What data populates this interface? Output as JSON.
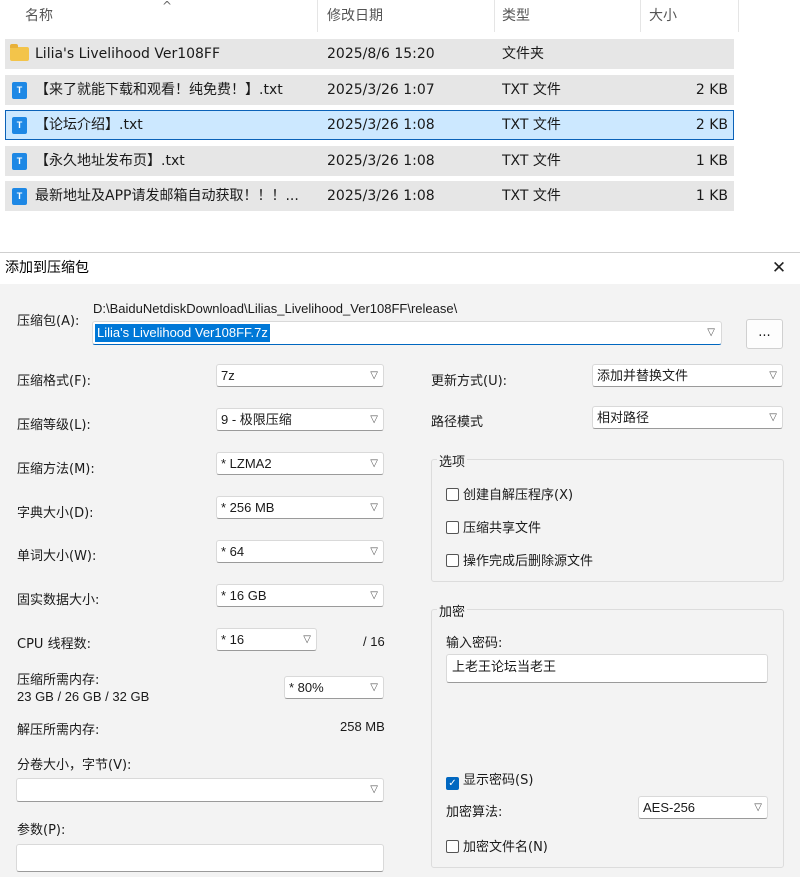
{
  "explorer": {
    "columns": [
      "名称",
      "修改日期",
      "类型",
      "大小"
    ],
    "files": [
      {
        "name": "Lilia's Livelihood Ver108FF",
        "date": "2025/8/6 15:20",
        "type": "文件夹",
        "size": "",
        "icon": "folder-icon"
      },
      {
        "name": "【来了就能下载和观看！纯免费！】.txt",
        "date": "2025/3/26 1:07",
        "type": "TXT 文件",
        "size": "2 KB",
        "icon": "txt-file-icon"
      },
      {
        "name": "【论坛介绍】.txt",
        "date": "2025/3/26 1:08",
        "type": "TXT 文件",
        "size": "2 KB",
        "icon": "txt-file-icon",
        "selected": true
      },
      {
        "name": "【永久地址发布页】.txt",
        "date": "2025/3/26 1:08",
        "type": "TXT 文件",
        "size": "1 KB",
        "icon": "txt-file-icon"
      },
      {
        "name": "最新地址及APP请发邮箱自动获取！！！...",
        "date": "2025/3/26 1:08",
        "type": "TXT 文件",
        "size": "1 KB",
        "icon": "txt-file-icon"
      }
    ]
  },
  "dialog": {
    "title": "添加到压缩包",
    "archive_label": "压缩包(A):",
    "archive_path": "D:\\BaiduNetdiskDownload\\Lilias_Livelihood_Ver108FF\\release\\",
    "archive_name": "Lilia's Livelihood Ver108FF.7z",
    "browse_label": "...",
    "format_label": "压缩格式(F):",
    "format_value": "7z",
    "level_label": "压缩等级(L):",
    "level_value": "9 - 极限压缩",
    "method_label": "压缩方法(M):",
    "method_value": "*  LZMA2",
    "dict_label": "字典大小(D):",
    "dict_value": "*  256 MB",
    "word_label": "单词大小(W):",
    "word_value": "*  64",
    "solid_label": "固实数据大小:",
    "solid_value": "*  16 GB",
    "cpu_label": "CPU 线程数:",
    "cpu_value": "*  16",
    "cpu_total": "/ 16",
    "mem_label": "压缩所需内存:",
    "mem_value": "23 GB / 26 GB / 32 GB",
    "mem_pct": "*  80%",
    "decomp_label": "解压所需内存:",
    "decomp_value": "258 MB",
    "volume_label": "分卷大小，字节(V):",
    "volume_value": "",
    "params_label": "参数(P):",
    "params_value": "",
    "update_label": "更新方式(U):",
    "update_value": "添加并替换文件",
    "path_label": "路径模式",
    "path_value": "相对路径",
    "options": {
      "title": "选项",
      "sfx": "创建自解压程序(X)",
      "shared": "压缩共享文件",
      "delete": "操作完成后删除源文件"
    },
    "encryption": {
      "title": "加密",
      "password_label": "输入密码:",
      "password_value": "上老王论坛当老王",
      "show_password": "显示密码(S)",
      "method_label": "加密算法:",
      "method_value": "AES-256",
      "encrypt_names": "加密文件名(N)"
    }
  }
}
